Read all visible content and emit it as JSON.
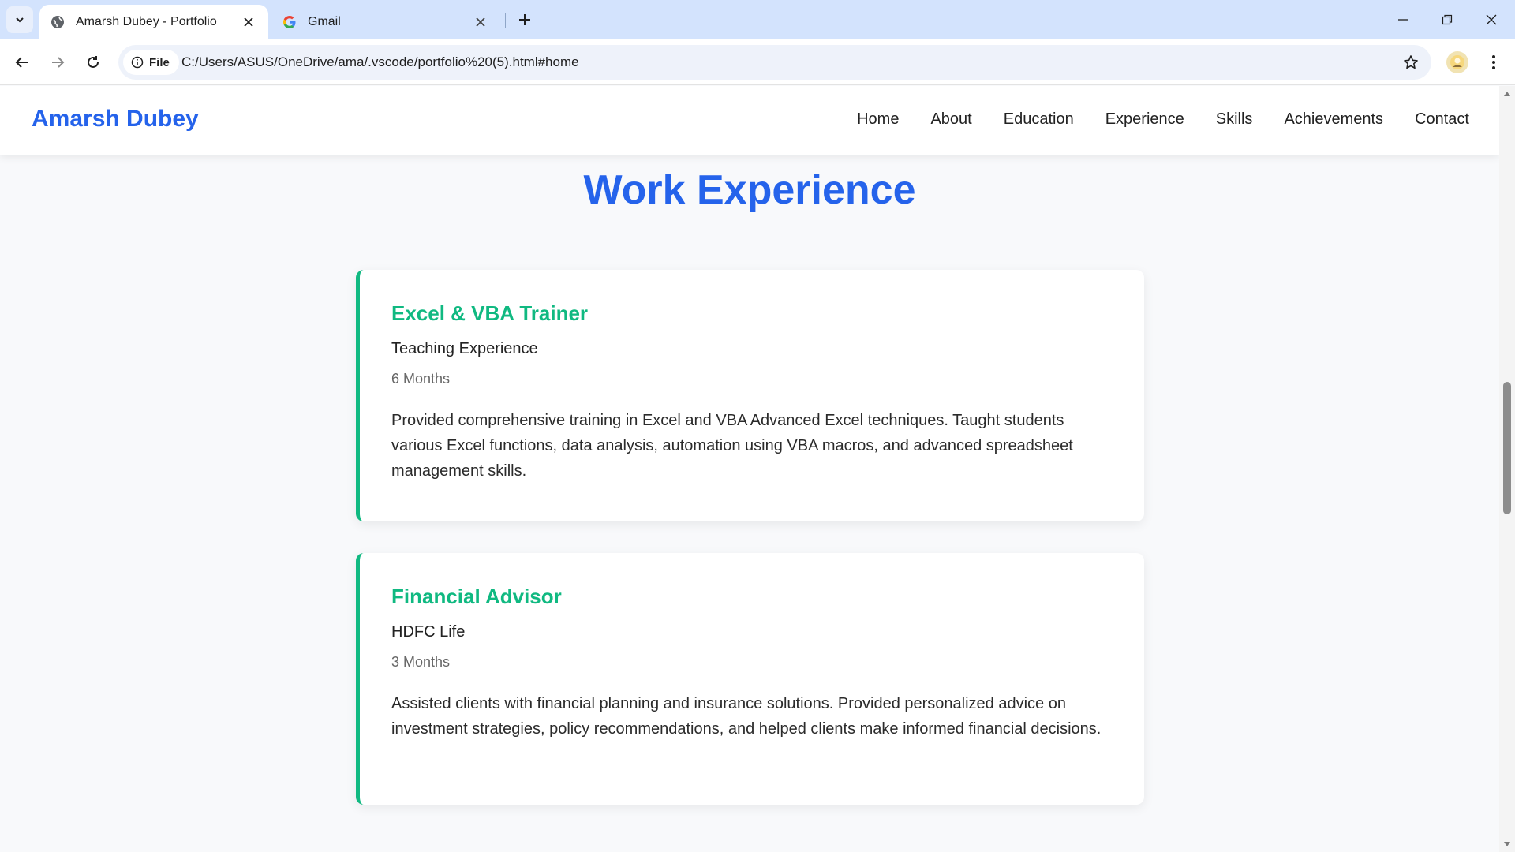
{
  "browser": {
    "tabs": [
      {
        "title": "Amarsh Dubey - Portfolio",
        "icon": "globe-icon",
        "active": true
      },
      {
        "title": "Gmail",
        "icon": "google-icon",
        "active": false
      }
    ],
    "site_info_label": "File",
    "url": "C:/Users/ASUS/OneDrive/ama/.vscode/portfolio%20(5).html#home"
  },
  "site": {
    "logo": "Amarsh Dubey",
    "nav": [
      "Home",
      "About",
      "Education",
      "Experience",
      "Skills",
      "Achievements",
      "Contact"
    ]
  },
  "experience": {
    "title": "Work Experience",
    "items": [
      {
        "role": "Excel & VBA Trainer",
        "company": "Teaching Experience",
        "duration": "6 Months",
        "description": "Provided comprehensive training in Excel and VBA Advanced Excel techniques. Taught students various Excel functions, data analysis, automation using VBA macros, and advanced spreadsheet management skills."
      },
      {
        "role": "Financial Advisor",
        "company": "HDFC Life",
        "duration": "3 Months",
        "description": "Assisted clients with financial planning and insurance solutions. Provided personalized advice on investment strategies, policy recommendations, and helped clients make informed financial decisions."
      }
    ]
  },
  "colors": {
    "brand_blue": "#2563eb",
    "accent_green": "#10b981",
    "tabstrip": "#d3e3fd"
  }
}
